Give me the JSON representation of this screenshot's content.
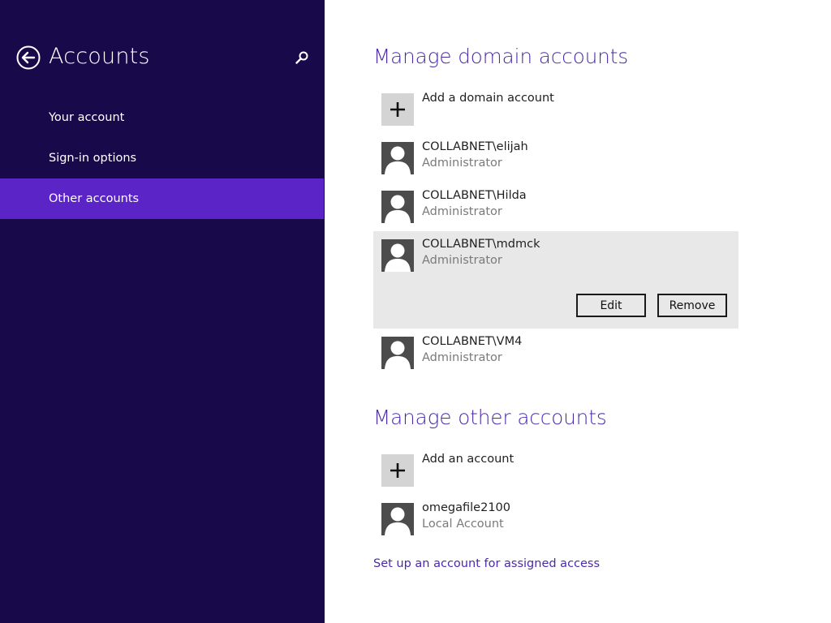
{
  "colors": {
    "sidebar_bg": "#180a4a",
    "sidebar_selected": "#5a24c6",
    "accent": "#4b2aa8",
    "selected_row_bg": "#e8e8e8"
  },
  "sidebar": {
    "title": "Accounts",
    "back_icon": "back-arrow-icon",
    "search_icon": "search-icon",
    "items": [
      {
        "label": "Your account",
        "selected": false
      },
      {
        "label": "Sign-in options",
        "selected": false
      },
      {
        "label": "Other accounts",
        "selected": true
      }
    ]
  },
  "domain_section": {
    "title": "Manage domain accounts",
    "add_label": "Add a domain account",
    "accounts": [
      {
        "name": "COLLABNET\\elijah",
        "role": "Administrator"
      },
      {
        "name": "COLLABNET\\Hilda",
        "role": "Administrator"
      },
      {
        "name": "COLLABNET\\mdmck",
        "role": "Administrator"
      },
      {
        "name": "COLLABNET\\VM4",
        "role": "Administrator"
      }
    ],
    "edit_label": "Edit",
    "remove_label": "Remove"
  },
  "other_section": {
    "title": "Manage other accounts",
    "add_label": "Add an account",
    "accounts": [
      {
        "name": "omegafile2100",
        "role": "Local Account"
      }
    ]
  },
  "assigned_access_link": "Set up an account for assigned access"
}
